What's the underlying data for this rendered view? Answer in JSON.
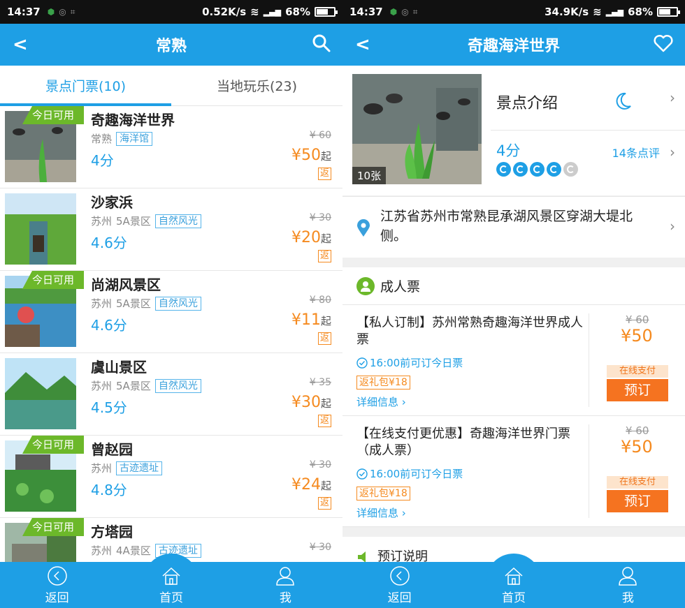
{
  "status_left": {
    "time": "14:37",
    "speed": "0.52K/s",
    "battery": "68%",
    "battery_level": 0.68
  },
  "status_right": {
    "time": "14:37",
    "speed": "34.9K/s",
    "battery": "68%",
    "battery_level": 0.68
  },
  "left": {
    "title": "常熟",
    "tabs": [
      "景点门票(10)",
      "当地玩乐(23)"
    ],
    "items": [
      {
        "today": "今日可用",
        "name": "奇趣海洋世界",
        "city": "常熟",
        "level": "",
        "tag": "海洋馆",
        "score": "4分",
        "old": "¥ 60",
        "price": "¥50",
        "unit": "起",
        "fan": "返",
        "img": "aquarium"
      },
      {
        "today": "",
        "name": "沙家浜",
        "city": "苏州",
        "level": "5A景区",
        "tag": "自然风光",
        "score": "4.6分",
        "old": "¥ 30",
        "price": "¥20",
        "unit": "起",
        "fan": "返",
        "img": "reed"
      },
      {
        "today": "今日可用",
        "name": "尚湖风景区",
        "city": "苏州",
        "level": "5A景区",
        "tag": "自然风光",
        "score": "4.6分",
        "old": "¥ 80",
        "price": "¥11",
        "unit": "起",
        "fan": "返",
        "img": "lake"
      },
      {
        "today": "",
        "name": "虞山景区",
        "city": "苏州",
        "level": "5A景区",
        "tag": "自然风光",
        "score": "4.5分",
        "old": "¥ 35",
        "price": "¥30",
        "unit": "起",
        "fan": "返",
        "img": "mountain"
      },
      {
        "today": "今日可用",
        "name": "曾赵园",
        "city": "苏州",
        "level": "",
        "tag": "古迹遗址",
        "score": "4.8分",
        "old": "¥ 30",
        "price": "¥24",
        "unit": "起",
        "fan": "返",
        "img": "garden"
      },
      {
        "today": "今日可用",
        "name": "方塔园",
        "city": "苏州",
        "level": "4A景区",
        "tag": "古迹遗址",
        "score": "",
        "old": "¥ 30",
        "price": "",
        "unit": "",
        "fan": "",
        "img": "tower"
      }
    ]
  },
  "right": {
    "title": "奇趣海洋世界",
    "photo_count": "10张",
    "intro": "景点介绍",
    "score": "4分",
    "rating": 4,
    "reviews": "14条点评",
    "address": "江苏省苏州市常熟昆承湖风景区穿湖大堤北侧。",
    "section": "成人票",
    "tickets": [
      {
        "name": "【私人订制】苏州常熟奇趣海洋世界成人票",
        "time": "16:00前可订今日票",
        "gift": "返礼包¥18",
        "detail": "详细信息",
        "old": "¥ 60",
        "price": "¥50",
        "online": "在线支付",
        "book": "预订"
      },
      {
        "name": "【在线支付更优惠】奇趣海洋世界门票（成人票）",
        "time": "16:00前可订今日票",
        "gift": "返礼包¥18",
        "detail": "详细信息",
        "old": "¥ 60",
        "price": "¥50",
        "online": "在线支付",
        "book": "预订"
      }
    ],
    "notice": "预订说明"
  },
  "nav": {
    "back": "返回",
    "home": "首页",
    "me": "我"
  },
  "colors": {
    "brand": "#1e9fe5",
    "price": "#f58a1f",
    "badge": "#6cb82a",
    "book": "#f57320"
  }
}
